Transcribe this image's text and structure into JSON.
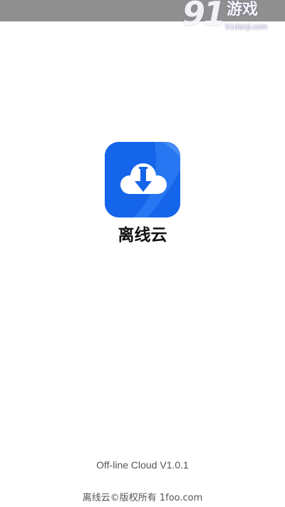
{
  "status_bar": {
    "color": "#8f8f8f"
  },
  "watermark": {
    "logo": "91",
    "title": "游戏",
    "url": "91danji.com"
  },
  "splash": {
    "app_icon": "cloud-download-icon",
    "app_name": "离线云",
    "accent_color": "#1565ea"
  },
  "footer": {
    "version": "Off-line Cloud V1.0.1",
    "copyright": "离线云©版权所有 1foo.com"
  }
}
